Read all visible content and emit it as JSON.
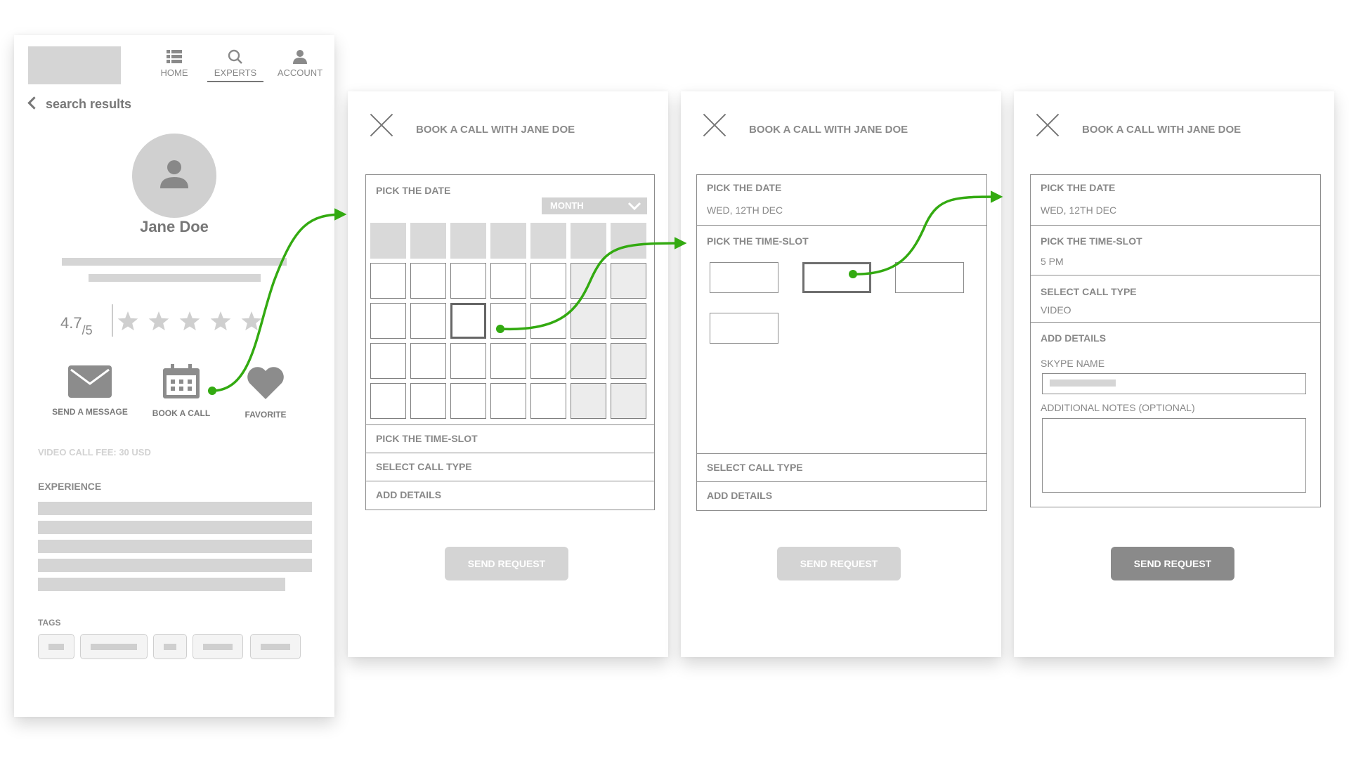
{
  "profile": {
    "nav": [
      {
        "label": "HOME",
        "icon": "grid-list-icon"
      },
      {
        "label": "EXPERTS",
        "icon": "search-icon"
      },
      {
        "label": "ACCOUNT",
        "icon": "user-icon"
      }
    ],
    "back_label": "search results",
    "name": "Jane Doe",
    "rating": "4.7",
    "rating_max": "/5",
    "stars_filled": 4.5,
    "actions": [
      {
        "label": "SEND A MESSAGE",
        "icon": "envelope-icon"
      },
      {
        "label": "BOOK A CALL",
        "icon": "calendar-icon"
      },
      {
        "label": "FAVORITE",
        "icon": "heart-icon"
      }
    ],
    "fee": "VIDEO CALL FEE: 30 USD",
    "experience_heading": "EXPERIENCE",
    "tags_heading": "TAGS"
  },
  "booking_title": "BOOK A CALL WITH JANE DOE",
  "sections": {
    "date": "PICK THE DATE",
    "timeslot": "PICK THE TIME-SLOT",
    "calltype": "SELECT CALL TYPE",
    "details": "ADD DETAILS"
  },
  "month_dropdown": "MONTH",
  "selected_date": "WED, 12TH DEC",
  "selected_time": "5 PM",
  "selected_call_type": "VIDEO",
  "skype_label": "SKYPE NAME",
  "notes_label": "ADDITIONAL NOTES (OPTIONAL)",
  "send_label": "SEND REQUEST",
  "colors": {
    "flow_arrow": "#33aa11",
    "wireframe_gray": "#d5d5d5",
    "button_active": "#8a8a8a",
    "button_disabled": "#d4d4d4"
  }
}
